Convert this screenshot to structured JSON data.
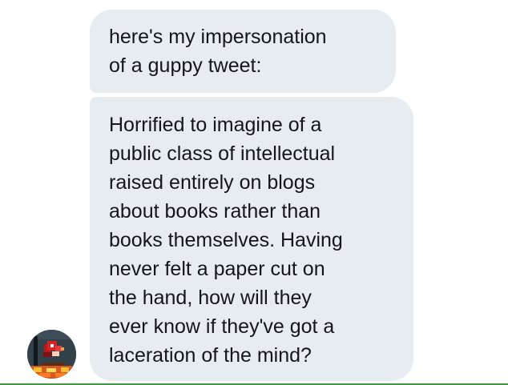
{
  "conversation": {
    "messages": [
      {
        "text": "here's my impersonation\nof a guppy tweet:"
      },
      {
        "text": "Horrified to imagine of a\npublic class of intellectual\nraised entirely on blogs\nabout books rather than\nbooks themselves. Having\nnever felt a paper cut on\nthe hand, how will they\never know if they've got a\nlaceration of the mind?"
      }
    ],
    "sender_avatar_icon": "pixel-art-avatar"
  },
  "colors": {
    "bubble_background": "#e6ecf0",
    "text": "#14171a",
    "bottom_line": "#3d9a3d"
  }
}
